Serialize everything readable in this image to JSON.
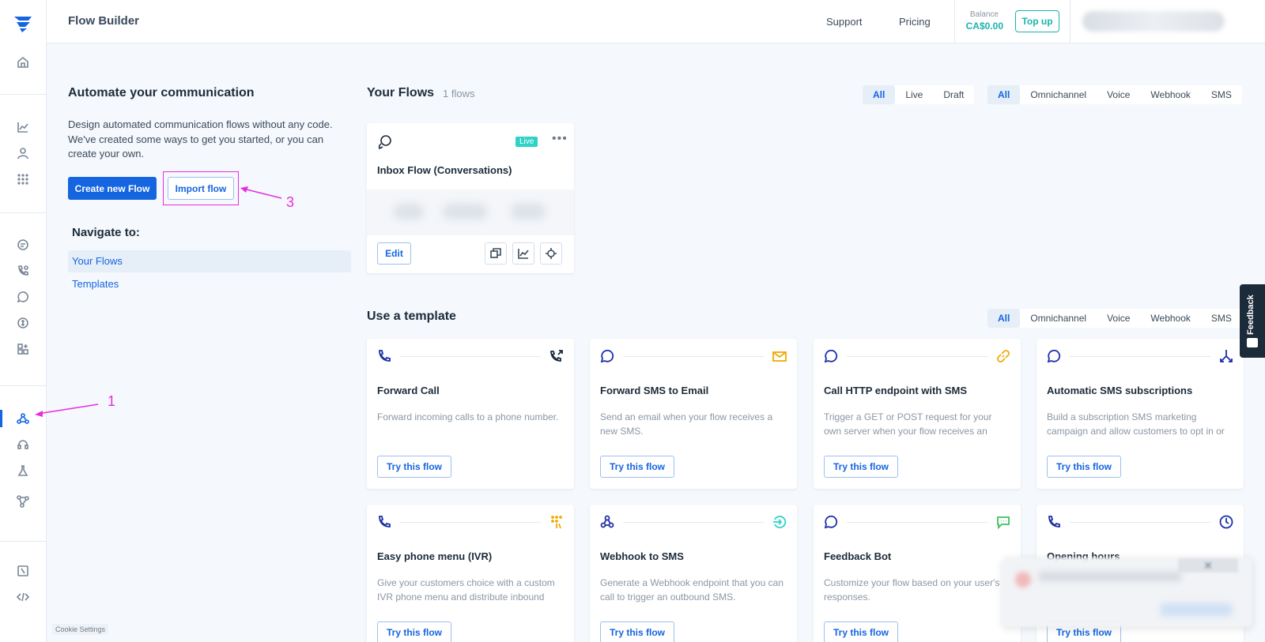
{
  "app": {
    "title": "Flow Builder",
    "cookie_settings": "Cookie Settings",
    "brand_color": "#1565e0",
    "accent_color": "#19b4ac",
    "annotation_color": "#e62ee0"
  },
  "header": {
    "support": "Support",
    "pricing": "Pricing",
    "balance_label": "Balance",
    "balance_value": "CA$0.00",
    "topup": "Top up"
  },
  "sidebar": {
    "icons": [
      "home-icon",
      "analytics-icon",
      "contacts-icon",
      "apps-grid-icon",
      "chat-icon",
      "voice-icon",
      "whatsapp-icon",
      "billing-icon",
      "integrations-icon",
      "flow-builder-icon",
      "support-headset-icon",
      "lab-icon",
      "connectors-icon",
      "docs-icon",
      "developer-code-icon"
    ],
    "active": "flow-builder-icon"
  },
  "intro": {
    "title": "Automate your communication",
    "description": "Design automated communication flows without any code. We've created some ways to get you started, or you can create your own.",
    "create_button": "Create new Flow",
    "import_button": "Import flow"
  },
  "navigate": {
    "title": "Navigate to:",
    "items": [
      "Your Flows",
      "Templates"
    ]
  },
  "annotations": {
    "one": "1",
    "three": "3"
  },
  "your_flows": {
    "title": "Your Flows",
    "count": "1 flows",
    "status_filters": [
      "All",
      "Live",
      "Draft"
    ],
    "channel_filters": [
      "All",
      "Omnichannel",
      "Voice",
      "Webhook",
      "SMS"
    ],
    "flow": {
      "status": "Live",
      "name": "Inbox Flow (Conversations)",
      "edit": "Edit"
    }
  },
  "templates": {
    "title": "Use a template",
    "channel_filters": [
      "All",
      "Omnichannel",
      "Voice",
      "Webhook",
      "SMS"
    ],
    "try_label": "Try this flow",
    "cards": [
      {
        "name": "Forward Call",
        "desc": "Forward incoming calls to a phone number.",
        "left_icon": "phone-icon",
        "right_icon": "call-forward-icon"
      },
      {
        "name": "Forward SMS to Email",
        "desc": "Send an email when your flow receives a new SMS.",
        "left_icon": "sms-bubble-icon",
        "right_icon": "email-icon"
      },
      {
        "name": "Call HTTP endpoint with SMS",
        "desc": "Trigger a GET or POST request for your own server when your flow receives an incoming SMS.",
        "left_icon": "sms-bubble-icon",
        "right_icon": "link-icon"
      },
      {
        "name": "Automatic SMS subscriptions",
        "desc": "Build a subscription SMS marketing campaign and allow customers to opt in or out.",
        "left_icon": "sms-bubble-icon",
        "right_icon": "split-icon"
      },
      {
        "name": "Easy phone menu (IVR)",
        "desc": "Give your customers choice with a custom IVR phone menu and distribute inbound calls.",
        "left_icon": "phone-icon",
        "right_icon": "keypad-icon"
      },
      {
        "name": "Webhook to SMS",
        "desc": "Generate a Webhook endpoint that you can call to trigger an outbound SMS.",
        "left_icon": "webhook-icon",
        "right_icon": "send-icon"
      },
      {
        "name": "Feedback Bot",
        "desc": "Customize your flow based on your user's responses.",
        "left_icon": "sms-bubble-icon",
        "right_icon": "feedback-bubble-icon"
      },
      {
        "name": "Opening hours",
        "desc": "",
        "left_icon": "phone-icon",
        "right_icon": "clock-icon"
      }
    ]
  },
  "feedback_tab": "Feedback"
}
